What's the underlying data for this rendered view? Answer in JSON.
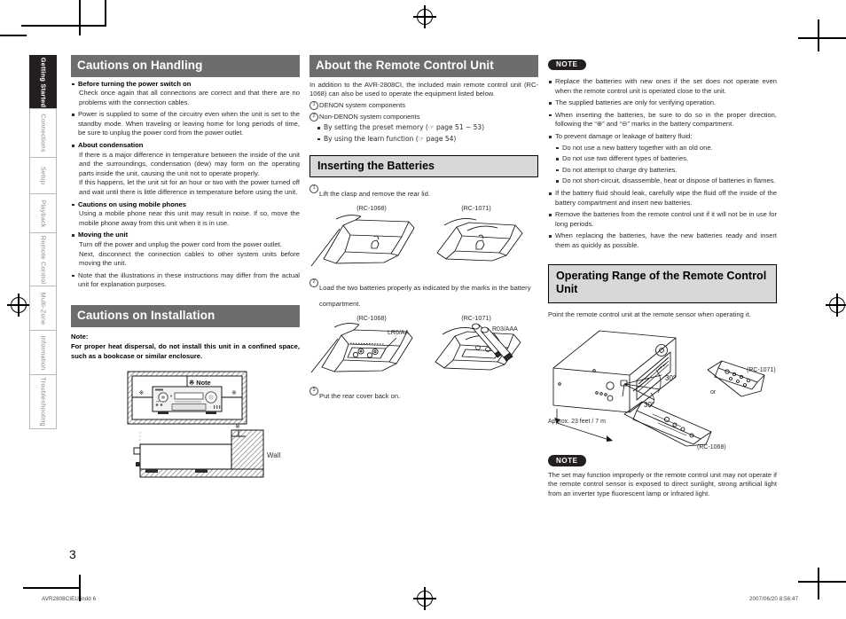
{
  "page": {
    "number": "3",
    "footer_file": "AVR2808CIEU.indd   6",
    "footer_timestamp": "2007/06/20    8:56:47"
  },
  "side_tabs": [
    {
      "label": "Getting Started",
      "active": true
    },
    {
      "label": "Connections",
      "active": false
    },
    {
      "label": "Setup",
      "active": false
    },
    {
      "label": "Playback",
      "active": false
    },
    {
      "label": "Remote Control",
      "active": false
    },
    {
      "label": "Multi-Zone",
      "active": false
    },
    {
      "label": "Information",
      "active": false
    },
    {
      "label": "Troubleshooting",
      "active": false
    }
  ],
  "column_1": {
    "heading_handling": "Cautions on Handling",
    "items": [
      {
        "title": "Before turning the power switch on",
        "body": "Check once again that all connections are correct and that there are no problems with the connection cables."
      },
      {
        "title": "",
        "body": "Power is supplied to some of the circuitry even when the unit is set to the standby mode. When traveling or leaving home for long periods of time, be sure to unplug the power cord from the power outlet."
      },
      {
        "title": "About condensation",
        "body": "If there is a major difference in temperature between the inside of the unit and the surroundings, condensation (dew) may form on the operating parts inside the unit, causing the unit not to operate properly.",
        "body2": "If this happens, let the unit sit for an hour or two with the power turned off and wait until there is little difference in temperature before using the unit."
      },
      {
        "title": "Cautions on using mobile phones",
        "body": "Using a mobile phone near this unit may result in noise. If so, move the mobile phone away from this unit when it is in use."
      },
      {
        "title": "Moving the unit",
        "body": "Turn off the power and unplug the power cord from the power outlet.",
        "body2": "Next, disconnect the connection cables to other system units before moving the unit."
      },
      {
        "title": "",
        "body": "Note that the illustrations in these instructions may differ from the actual unit for explanation purposes."
      }
    ],
    "heading_installation": "Cautions on Installation",
    "note_label": "Note:",
    "note_body": "For proper heat dispersal, do not install this unit in a confined space, such as a bookcase or similar enclosure.",
    "figure": {
      "note_callout": "※ Note",
      "mark": "※",
      "wall_label": "Wall"
    }
  },
  "column_2": {
    "heading_remote": "About the Remote Control Unit",
    "intro": "In addition to the AVR-2808CI, the included main remote control unit (RC-1068) can also be used to operate the equipment listed below.",
    "numbered": [
      {
        "n": "1",
        "text": "DENON system components"
      },
      {
        "n": "2",
        "text": "Non-DENON system components"
      }
    ],
    "sub_bullets": [
      "By setting the preset memory (☞ page 51 ~ 53)",
      "By using the learn function (☞ page 54)"
    ],
    "heading_batteries": "Inserting the Batteries",
    "step1": "Lift the clasp and remove the rear lid.",
    "step2": "Load the two batteries properly as indicated by the marks in the battery compartment.",
    "step3": "Put the rear cover back on.",
    "fig1_left_caption": "(RC-1068)",
    "fig1_right_caption": "(RC-1071)",
    "fig2_left_caption": "(RC-1068)",
    "fig2_right_caption": "(RC-1071)",
    "battery_aa": "LR6/AA",
    "battery_aaa": "R03/AAA"
  },
  "column_3": {
    "note_label": "NOTE",
    "note_bullets": [
      "Replace the batteries with new ones if the set does not operate even when the remote control unit is operated close to the unit.",
      "The supplied batteries are only for verifying operation.",
      "When inserting the batteries, be sure to do so in the proper direction, following the “⊕” and “⊖” marks in the battery compartment.",
      "To prevent damage or leakage of battery fluid:"
    ],
    "note_sub_bullets": [
      "Do not use a new battery together with an old one.",
      "Do not use two different types of batteries.",
      "Do not attempt to charge dry batteries.",
      "Do not short-circuit, disassemble, heat or dispose of batteries in flames."
    ],
    "note_bullets_2": [
      "If the battery fluid should leak, carefully wipe the fluid off the inside of the battery compartment and insert new batteries.",
      "Remove the batteries from the remote control unit if it will not be in use for long periods.",
      "When replacing the batteries, have the new batteries ready and insert them as quickly as possible."
    ],
    "heading_range": "Operating Range of the Remote Control Unit",
    "range_intro": "Point the remote control unit at the remote sensor when operating it.",
    "figure": {
      "angle_top": "30°",
      "angle_bottom": "30°",
      "distance": "Approx. 23 feet / 7 m",
      "remote_1071": "(RC-1071)",
      "remote_1068": "(RC-1068)",
      "or_label": "or"
    },
    "note_label_2": "NOTE",
    "note_body_2": "The set may function improperly or the remote control unit may not operate if the remote control sensor is exposed to direct sunlight, strong artificial light from an inverter type fluorescent lamp or infrared light."
  },
  "colors": {
    "heading_bar": "#6d6d6d",
    "subheading": "#d8d8d8",
    "tab_active": "#231f20",
    "text": "#2b2b2b"
  }
}
